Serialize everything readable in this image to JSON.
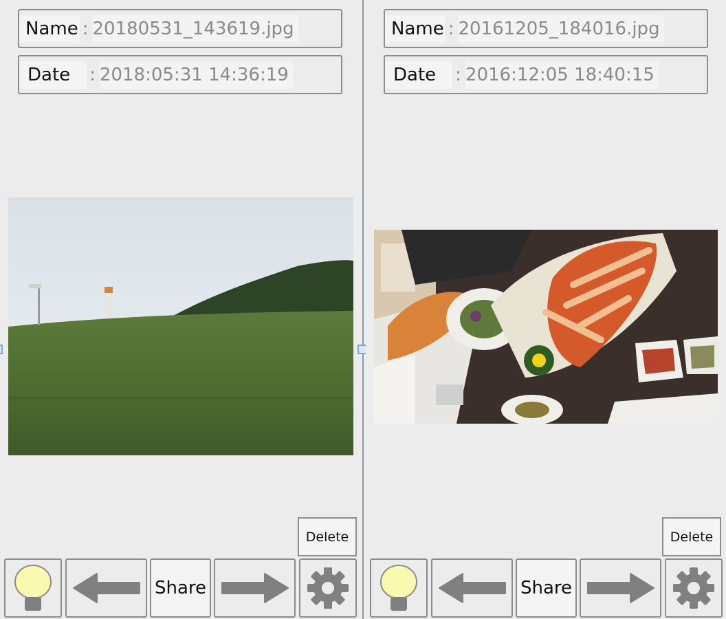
{
  "panels": [
    {
      "name_label": "Name",
      "name_sep": ":",
      "name_value": "20180531_143619.jpg",
      "date_label": "Date",
      "date_sep": ":",
      "date_value": "2018:05:31 14:36:19",
      "delete_label": "Delete",
      "share_label": "Share"
    },
    {
      "name_label": "Name",
      "name_sep": ":",
      "name_value": "20161205_184016.jpg",
      "date_label": "Date",
      "date_sep": ":",
      "date_value": "2016:12:05 18:40:15",
      "delete_label": "Delete",
      "share_label": "Share"
    }
  ],
  "icons": [
    "bulb-icon",
    "arrow-left-icon",
    "arrow-right-icon",
    "gear-icon"
  ],
  "colors": {
    "background": "#ececec",
    "border": "#8c8c8c",
    "muted_text": "#8a8a8a",
    "icon_gray": "#808080",
    "bulb_fill": "#fbf8b0",
    "divider": "#8a9aab"
  }
}
